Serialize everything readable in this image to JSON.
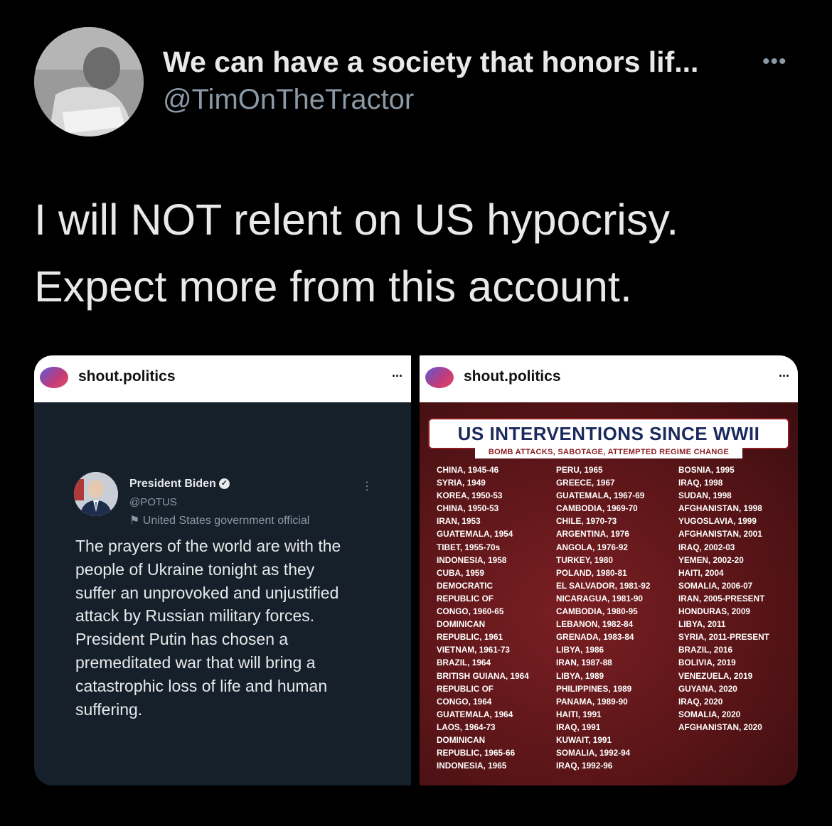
{
  "tweet": {
    "display_name": "We can have a society that honors lif...",
    "handle": "@TimOnTheTractor",
    "more_icon": "more-horizontal-icon",
    "text_lines": [
      "I will NOT relent on US hypocrisy.",
      "Expect more from this account."
    ]
  },
  "left_image": {
    "account": "shout.politics",
    "more": "...",
    "embedded_tweet": {
      "name": "President Biden",
      "verified_icon": "verified-badge-icon",
      "handle": "@POTUS",
      "label": "United States government official",
      "label_icon": "flag-icon",
      "more": "⋮",
      "text_lines": [
        "The prayers of the world are with the",
        "people of Ukraine tonight as they",
        "suffer an unprovoked and unjustified",
        "attack by Russian military forces.",
        "President Putin has chosen a",
        "premeditated war that will bring a",
        "catastrophic loss of life and human",
        "suffering."
      ]
    }
  },
  "right_image": {
    "account": "shout.politics",
    "more": "...",
    "title": "US INTERVENTIONS SINCE WWII",
    "subtitle": "BOMB ATTACKS, SABOTAGE, ATTEMPTED REGIME CHANGE",
    "columns": [
      [
        "CHINA, 1945-46",
        "SYRIA, 1949",
        "KOREA, 1950-53",
        "CHINA, 1950-53",
        "IRAN, 1953",
        "GUATEMALA, 1954",
        "TIBET, 1955-70s",
        "INDONESIA, 1958",
        "CUBA, 1959",
        "DEMOCRATIC",
        "REPUBLIC OF",
        "CONGO, 1960-65",
        "DOMINICAN",
        "REPUBLIC, 1961",
        "VIETNAM, 1961-73",
        "BRAZIL, 1964",
        "BRITISH GUIANA, 1964",
        "REPUBLIC OF",
        "CONGO, 1964",
        "GUATEMALA, 1964",
        "LAOS, 1964-73",
        "DOMINICAN",
        "REPUBLIC, 1965-66",
        "INDONESIA, 1965"
      ],
      [
        "PERU, 1965",
        "GREECE, 1967",
        "GUATEMALA, 1967-69",
        "CAMBODIA, 1969-70",
        "CHILE, 1970-73",
        "ARGENTINA, 1976",
        "ANGOLA, 1976-92",
        "TURKEY, 1980",
        "POLAND, 1980-81",
        "EL SALVADOR, 1981-92",
        "NICARAGUA, 1981-90",
        "CAMBODIA, 1980-95",
        "LEBANON, 1982-84",
        "GRENADA, 1983-84",
        "LIBYA, 1986",
        "IRAN, 1987-88",
        "LIBYA, 1989",
        "PHILIPPINES, 1989",
        "PANAMA, 1989-90",
        "HAITI, 1991",
        "IRAQ, 1991",
        "KUWAIT, 1991",
        "SOMALIA, 1992-94",
        "IRAQ, 1992-96"
      ],
      [
        "BOSNIA, 1995",
        "IRAQ, 1998",
        "SUDAN, 1998",
        "AFGHANISTAN, 1998",
        "YUGOSLAVIA, 1999",
        "AFGHANISTAN, 2001",
        "IRAQ, 2002-03",
        "YEMEN, 2002-20",
        "HAITI, 2004",
        "SOMALIA, 2006-07",
        "IRAN, 2005-PRESENT",
        "HONDURAS, 2009",
        "LIBYA, 2011",
        "SYRIA, 2011-PRESENT",
        "BRAZIL, 2016",
        "BOLIVIA, 2019",
        "VENEZUELA, 2019",
        "GUYANA, 2020",
        "IRAQ, 2020",
        "SOMALIA, 2020",
        "AFGHANISTAN, 2020"
      ]
    ]
  },
  "colors": {
    "background": "#000000",
    "text_primary": "#e7e9ea",
    "text_secondary": "#8b98a5",
    "poster_red": "#5a1518",
    "poster_navy": "#1a2a5e",
    "embed_bg": "#16202b"
  }
}
